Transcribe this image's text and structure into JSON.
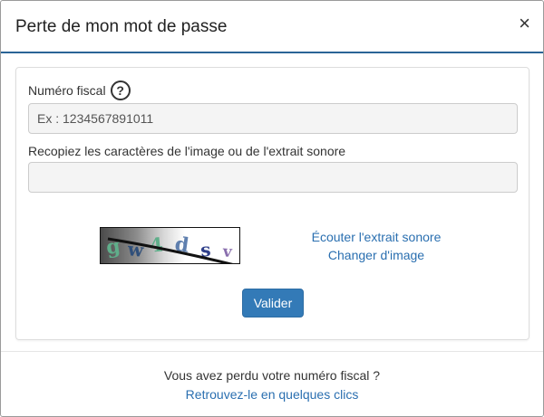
{
  "dialog": {
    "title": "Perte de mon mot de passe",
    "close_glyph": "×"
  },
  "form": {
    "fiscal_label": "Numéro fiscal",
    "help_glyph": "?",
    "fiscal_placeholder": "Ex : 1234567891011",
    "fiscal_value": "",
    "captcha_label": "Recopiez les caractères de l'image ou de l'extrait sonore",
    "captcha_value": "",
    "captcha_chars": [
      "g",
      "w",
      "4",
      "d",
      "s",
      "v"
    ],
    "listen_link": "Écouter l'extrait sonore",
    "change_image_link": "Changer d'image",
    "submit_label": "Valider"
  },
  "footer": {
    "question": "Vous avez perdu votre numéro fiscal ?",
    "link": "Retrouvez-le en quelques clics"
  },
  "colors": {
    "accent": "#337ab7",
    "link": "#2a6fb0",
    "header_rule": "#2a6496"
  },
  "icons": {
    "close": "close-icon",
    "help": "help-icon"
  }
}
